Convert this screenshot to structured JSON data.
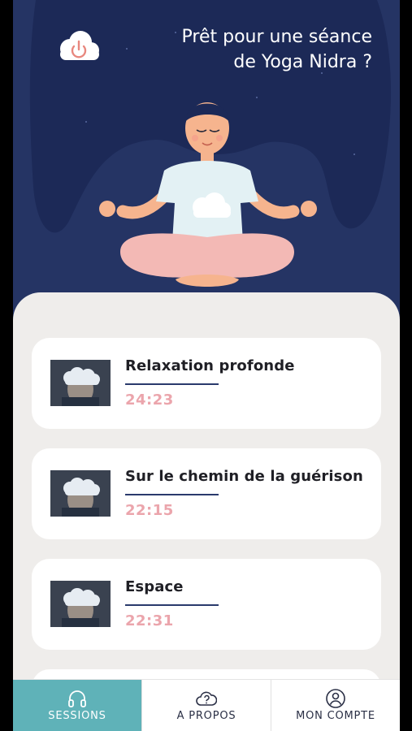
{
  "header": {
    "greeting_line1": "Prêt pour une séance",
    "greeting_line2": "de Yoga Nidra ?"
  },
  "sessions": [
    {
      "title": "Relaxation profonde",
      "duration": "24:23"
    },
    {
      "title": "Sur le chemin de la guérison",
      "duration": "22:15"
    },
    {
      "title": "Espace",
      "duration": "22:31"
    }
  ],
  "tabs": [
    {
      "label": "SESSIONS",
      "icon": "headphones-icon",
      "active": true
    },
    {
      "label": "A PROPOS",
      "icon": "question-cloud-icon",
      "active": false
    },
    {
      "label": "MON COMPTE",
      "icon": "user-icon",
      "active": false
    }
  ],
  "colors": {
    "hero_background": "#253464",
    "accent_teal": "#5fb2b8",
    "duration_pink": "#eba5ac",
    "divider_navy": "#2a3a6c"
  }
}
